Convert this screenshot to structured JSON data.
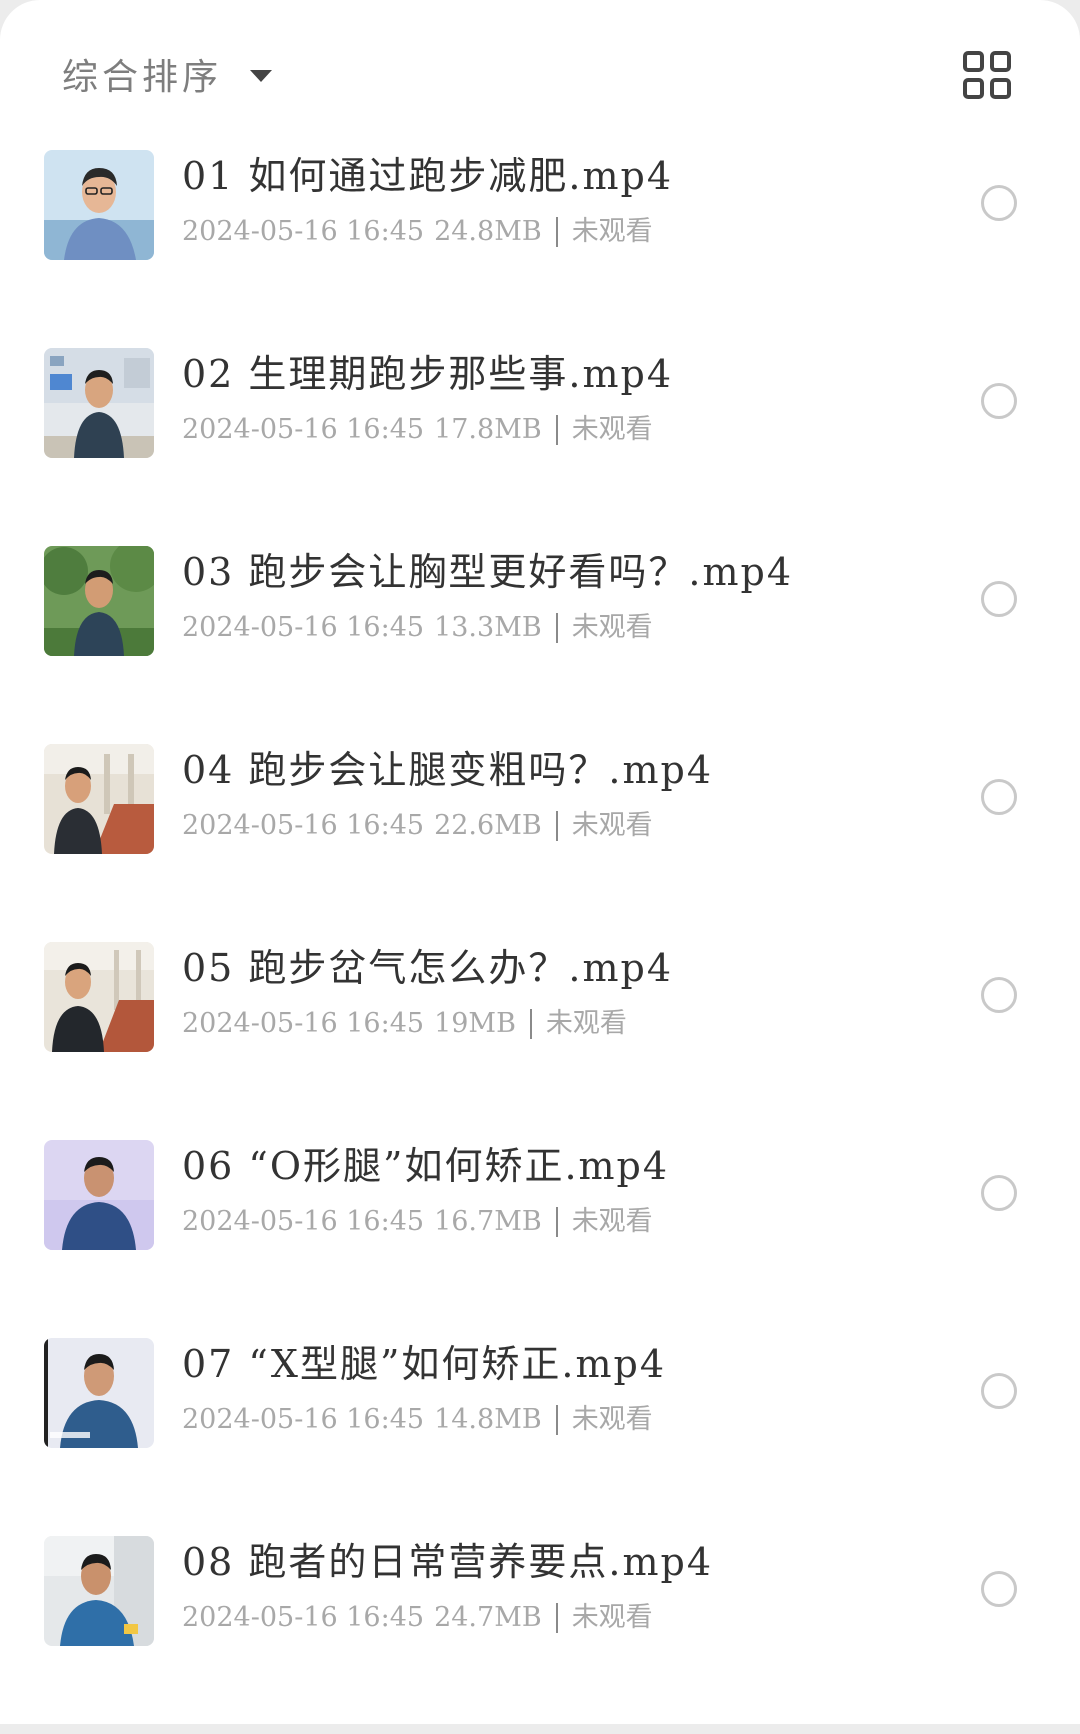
{
  "header": {
    "sort_label": "综合排序",
    "sort_icon": "caret-down-icon",
    "view_toggle_icon": "grid-view-icon"
  },
  "colors": {
    "title": "#333333",
    "meta": "#a8a8a8",
    "radio_border": "#c9c9c9",
    "background": "#ffffff"
  },
  "files": [
    {
      "title": "01 如何通过跑步减肥.mp4",
      "date": "2024-05-16 16:45",
      "size": "24.8MB",
      "status": "未观看"
    },
    {
      "title": "02 生理期跑步那些事.mp4",
      "date": "2024-05-16 16:45",
      "size": "17.8MB",
      "status": "未观看"
    },
    {
      "title": "03 跑步会让胸型更好看吗？.mp4",
      "date": "2024-05-16 16:45",
      "size": "13.3MB",
      "status": "未观看"
    },
    {
      "title": "04 跑步会让腿变粗吗？.mp4",
      "date": "2024-05-16 16:45",
      "size": "22.6MB",
      "status": "未观看"
    },
    {
      "title": "05 跑步岔气怎么办？.mp4",
      "date": "2024-05-16 16:45",
      "size": "19MB",
      "status": "未观看"
    },
    {
      "title": "06 “O形腿”如何矫正.mp4",
      "date": "2024-05-16 16:45",
      "size": "16.7MB",
      "status": "未观看"
    },
    {
      "title": "07 “X型腿”如何矫正.mp4",
      "date": "2024-05-16 16:45",
      "size": "14.8MB",
      "status": "未观看"
    },
    {
      "title": "08 跑者的日常营养要点.mp4",
      "date": "2024-05-16 16:45",
      "size": "24.7MB",
      "status": "未观看"
    }
  ]
}
